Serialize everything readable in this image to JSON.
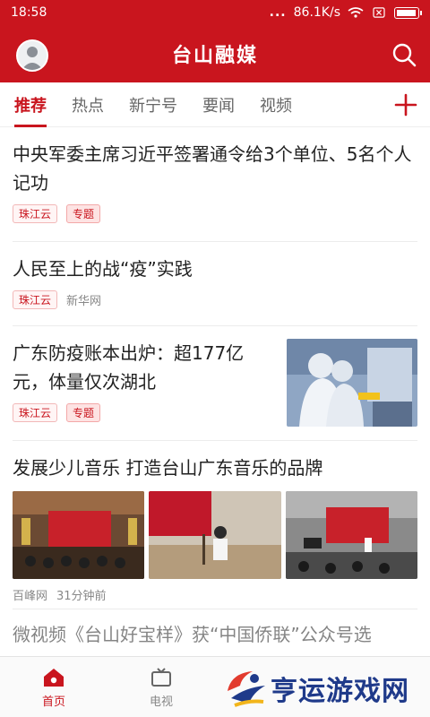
{
  "status_bar": {
    "time": "18:58",
    "dots": "...",
    "speed": "86.1K/s"
  },
  "header": {
    "title": "台山融媒"
  },
  "tabs": [
    {
      "label": "推荐"
    },
    {
      "label": "热点"
    },
    {
      "label": "新宁号"
    },
    {
      "label": "要闻"
    },
    {
      "label": "视频"
    }
  ],
  "feed": {
    "item1": {
      "title": "中央军委主席习近平签署通令给3个单位、5名个人记功",
      "tag1": "珠江云",
      "tag2": "专题"
    },
    "item2": {
      "title": "人民至上的战“疫”实践",
      "tag1": "珠江云",
      "source": "新华网"
    },
    "item3": {
      "title": "广东防疫账本出炉：超177亿元，体量仅次湖北",
      "tag1": "珠江云",
      "tag2": "专题"
    },
    "item4": {
      "title": "发展少儿音乐 打造台山广东音乐的品牌",
      "source": "百峰网",
      "time": "31分钟前"
    },
    "item5": {
      "title": "微视频《台山好宝样》获“中国侨联”公众号选"
    }
  },
  "bottom_nav": [
    {
      "label": "首页"
    },
    {
      "label": "电视"
    },
    {
      "label": ""
    },
    {
      "label": ""
    }
  ],
  "watermark": {
    "text": "亨运游戏网"
  },
  "colors": {
    "brand_red": "#c9151e",
    "watermark_blue": "#1f3a8a"
  }
}
